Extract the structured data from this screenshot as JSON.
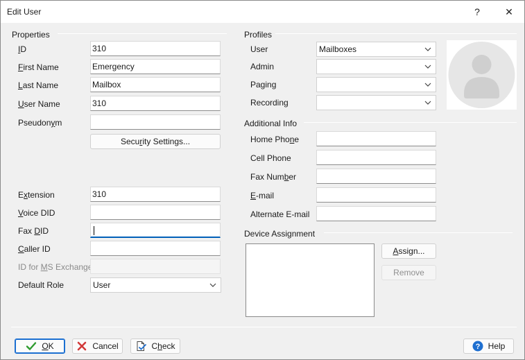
{
  "window": {
    "title": "Edit User",
    "help_glyph": "?",
    "close_glyph": "✕"
  },
  "properties": {
    "group_label": "Properties",
    "id": {
      "label_pre": "",
      "label_mn": "I",
      "label_post": "D",
      "value": "310"
    },
    "first_name": {
      "label_pre": "",
      "label_mn": "F",
      "label_post": "irst Name",
      "value": "Emergency"
    },
    "last_name": {
      "label_pre": "",
      "label_mn": "L",
      "label_post": "ast Name",
      "value": "Mailbox"
    },
    "user_name": {
      "label_pre": "",
      "label_mn": "U",
      "label_post": "ser Name",
      "value": "310"
    },
    "pseudonym": {
      "label_pre": "Pseudon",
      "label_mn": "y",
      "label_post": "m",
      "value": ""
    },
    "security_button": {
      "label_pre": "Secu",
      "label_mn": "r",
      "label_post": "ity Settings..."
    },
    "extension": {
      "label_pre": "E",
      "label_mn": "x",
      "label_post": "tension",
      "value": "310"
    },
    "voice_did": {
      "label_pre": "",
      "label_mn": "V",
      "label_post": "oice DID",
      "value": ""
    },
    "fax_did": {
      "label_pre": "Fax ",
      "label_mn": "D",
      "label_post": "ID",
      "value": ""
    },
    "caller_id": {
      "label_pre": "",
      "label_mn": "C",
      "label_post": "aller ID",
      "value": ""
    },
    "ms_exchange": {
      "label_pre": "ID for ",
      "label_mn": "M",
      "label_post": "S Exchange",
      "value": ""
    },
    "default_role": {
      "label": "Default Role",
      "value": "User"
    }
  },
  "profiles": {
    "group_label": "Profiles",
    "user": {
      "label": "User",
      "value": "Mailboxes"
    },
    "admin": {
      "label": "Admin",
      "value": ""
    },
    "paging": {
      "label": "Paging",
      "value": ""
    },
    "recording": {
      "label": "Recording",
      "value": ""
    }
  },
  "additional_info": {
    "group_label": "Additional Info",
    "home_phone": {
      "label_pre": "Home Pho",
      "label_mn": "n",
      "label_post": "e",
      "value": ""
    },
    "cell_phone": {
      "label": "Cell Phone",
      "value": ""
    },
    "fax_number": {
      "label_pre": "Fax Num",
      "label_mn": "b",
      "label_post": "er",
      "value": ""
    },
    "email": {
      "label_pre": "",
      "label_mn": "E",
      "label_post": "-mail",
      "value": ""
    },
    "alt_email": {
      "label": "Alternate E-mail",
      "value": ""
    }
  },
  "device_assignment": {
    "group_label": "Device Assignment",
    "assign_button": {
      "label_pre": "",
      "label_mn": "A",
      "label_post": "ssign..."
    },
    "remove_button": "Remove"
  },
  "footer": {
    "ok": {
      "label_pre": "",
      "label_mn": "O",
      "label_post": "K"
    },
    "cancel": "Cancel",
    "check": {
      "label_pre": "C",
      "label_mn": "h",
      "label_post": "eck"
    },
    "help": "Help"
  },
  "colors": {
    "accent": "#005fb8",
    "ok_icon": "#2e9b2e",
    "cancel_icon": "#d23a3a",
    "help_icon": "#1e6fd0"
  }
}
